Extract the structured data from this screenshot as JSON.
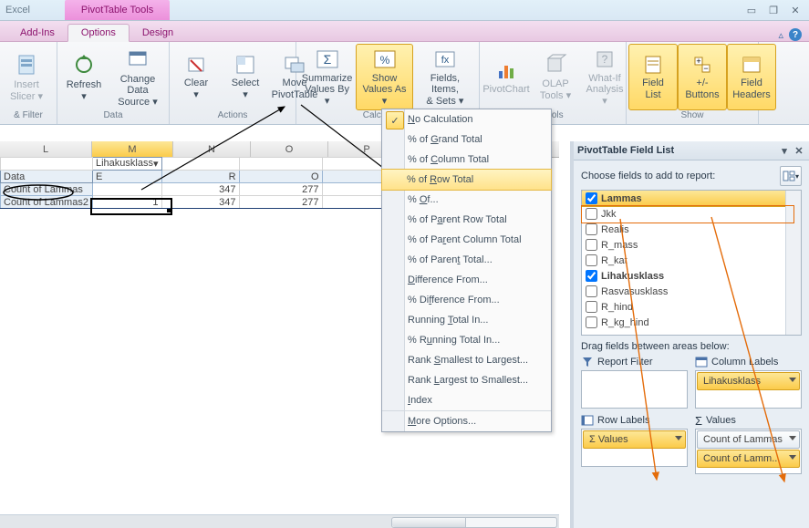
{
  "title": {
    "app": "Excel",
    "tools": "PivotTable Tools"
  },
  "tabs": {
    "addins": "Add-Ins",
    "options": "Options",
    "design": "Design"
  },
  "ribbon": {
    "filter_grp": "& Filter",
    "slicer": "Insert\nSlicer",
    "data_grp": "Data",
    "refresh": "Refresh",
    "chsrc": "Change Data\nSource",
    "actions_grp": "Actions",
    "clear": "Clear",
    "select": "Select",
    "move": "Move\nPivotTable",
    "calc_grp": "Calculations",
    "summ": "Summarize\nValues By",
    "showas": "Show\nValues As",
    "fis": "Fields, Items,\n& Sets",
    "tools_grp": "Tools",
    "pc": "PivotChart",
    "olap": "OLAP\nTools",
    "whatif": "What-If\nAnalysis",
    "show_grp": "Show",
    "flst": "Field\nList",
    "pm": "+/-\nButtons",
    "fh": "Field\nHeaders"
  },
  "dropdown": {
    "nocalc": "No Calculation",
    "gt": "% of Grand Total",
    "ct": "% of Column Total",
    "rt": "% of Row Total",
    "of": "% Of...",
    "prt": "% of Parent Row Total",
    "pct": "% of Parent Column Total",
    "pt": "% of Parent Total...",
    "df": "Difference From...",
    "pdf": "% Difference From...",
    "rti": "Running Total In...",
    "prti": "% Running Total In...",
    "rsl": "Rank Smallest to Largest...",
    "rls": "Rank Largest to Smallest...",
    "idx": "Index",
    "more": "More Options..."
  },
  "sheet": {
    "cols": [
      "L",
      "M",
      "N",
      "O",
      "P"
    ],
    "hdr_lk": "Lihakusklass",
    "hdr_data": "Data",
    "hdr_E": "E",
    "hdr_R": "R",
    "hdr_O": "O",
    "hdr_P": "P",
    "row1_lbl": "Count of Lammas",
    "row2_lbl": "Count of Lammas2",
    "v_n1": "347",
    "v_o1": "277",
    "v_m2": "1",
    "v_n2": "347",
    "v_o2": "277"
  },
  "pane": {
    "title": "PivotTable Field List",
    "choose": "Choose fields to add to report:",
    "f": {
      "lammas": "Lammas",
      "jkk": "Jkk",
      "realis": "Realis",
      "rmass": "R_mass",
      "rkat": "R_kat",
      "lk": "Lihakusklass",
      "rv": "Rasvasusklass",
      "rh": "R_hind",
      "rkg": "R_kg_hind"
    },
    "drag": "Drag fields between areas below:",
    "a": {
      "rf": "Report Filter",
      "cl": "Column Labels",
      "rl": "Row Labels",
      "va": "Values"
    },
    "chips": {
      "lk": "Lihakusklass",
      "vals": "Σ  Values",
      "c1": "Count of Lammas",
      "c2": "Count of Lamm..."
    }
  }
}
